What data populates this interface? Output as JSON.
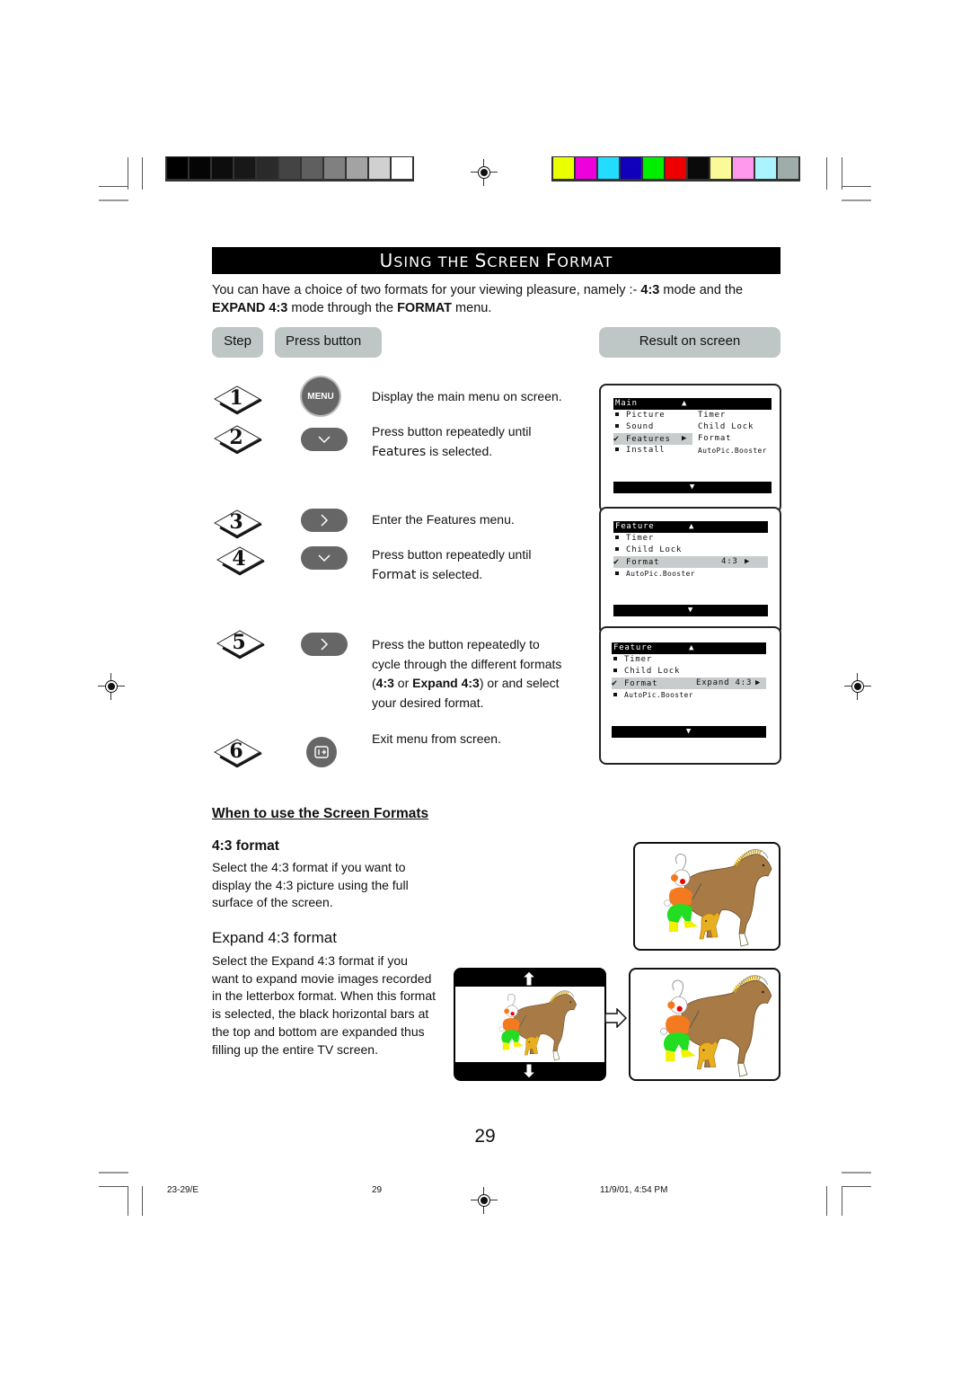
{
  "print_marks": {
    "gray_scale_swatches": [
      "#000000",
      "#050505",
      "#0d0d0d",
      "#181818",
      "#2a2a2a",
      "#444444",
      "#5f5f5f",
      "#808080",
      "#a3a3a3",
      "#d0d0d0",
      "#ffffff"
    ],
    "color_swatches": [
      "#eaff00",
      "#ee00dd",
      "#22ddff",
      "#1100bb",
      "#00ee00",
      "#ee0000",
      "#0a0a0a",
      "#fafa99",
      "#ff99ee",
      "#aaf4ff",
      "#9fadaa"
    ]
  },
  "header": {
    "title_first_U": "U",
    "title_rest_1": "SING THE ",
    "title_S": "S",
    "title_rest_2": "CREEN ",
    "title_F": "F",
    "title_rest_3": "ORMAT"
  },
  "intro": {
    "line1_a": "You can have a choice of two formats for your viewing pleasure, namely :- ",
    "line1_b": "4:3",
    "line1_c": " mode and the",
    "line2_a": "EXPAND 4:3",
    "line2_b": " mode through the ",
    "line2_c": "FORMAT",
    "line2_d": " menu."
  },
  "columns": {
    "step": "Step",
    "press_button": "Press button",
    "result": "Result on screen"
  },
  "steps": [
    {
      "num": "1",
      "button": "MENU",
      "button_icon": "menu-button",
      "text": "Display the main menu on screen."
    },
    {
      "num": "2",
      "button": "v",
      "button_icon": "down-arrow-button",
      "text_a": "Press button repeatedly until",
      "text_b_mono": "Features",
      "text_b_rest": " is selected."
    },
    {
      "num": "3",
      "button": ">",
      "button_icon": "right-arrow-button",
      "text": "Enter the Features menu."
    },
    {
      "num": "4",
      "button": "v",
      "button_icon": "down-arrow-button",
      "text_a": "Press button repeatedly until",
      "text_b_mono": "Format",
      "text_b_rest": " is selected."
    },
    {
      "num": "5",
      "button": ">",
      "button_icon": "right-arrow-button",
      "text_1": "Press the button repeatedly to",
      "text_2": "cycle through the different formats",
      "text_3_a": "(",
      "text_3_b": "4:3",
      "text_3_c": " or ",
      "text_3_d": "Expand 4:3",
      "text_3_e": ") or and select",
      "text_4": "your desired format."
    },
    {
      "num": "6",
      "button": "i+",
      "button_icon": "info-exit-button",
      "text": "Exit menu from screen."
    }
  ],
  "osd_screens": [
    {
      "title": "Main",
      "up": "▲",
      "down": "▼",
      "rows": [
        {
          "marker": "bullet",
          "label": "Picture",
          "right": "Timer"
        },
        {
          "marker": "bullet",
          "label": "Sound",
          "right": "Child Lock"
        },
        {
          "marker": "check",
          "label": "Features",
          "arrow": "▶",
          "right": "Format",
          "selected": true
        },
        {
          "marker": "bullet",
          "label": "Install",
          "right": "AutoPic.Booster"
        }
      ]
    },
    {
      "title": "Feature",
      "up": "▲",
      "down": "▼",
      "rows": [
        {
          "marker": "bullet",
          "label": "Timer"
        },
        {
          "marker": "bullet",
          "label": "Child Lock"
        },
        {
          "marker": "check",
          "label": "Format",
          "value": "4:3",
          "arrow": "▶",
          "selected": true
        },
        {
          "marker": "bullet",
          "label": "AutoPic.Booster"
        }
      ]
    },
    {
      "title": "Feature",
      "up": "▲",
      "down": "▼",
      "rows": [
        {
          "marker": "bullet",
          "label": "Timer"
        },
        {
          "marker": "bullet",
          "label": "Child Lock"
        },
        {
          "marker": "check",
          "label": "Format",
          "value": "Expand 4:3",
          "arrow": "▶",
          "selected": true
        },
        {
          "marker": "bullet",
          "label": "AutoPic.Booster"
        }
      ]
    }
  ],
  "when_section": {
    "heading": "When to use the Screen Formats",
    "format43_heading": "4:3 format",
    "format43_text": "Select the 4:3 format if you want to display the 4:3 picture using the full surface of the screen.",
    "expand_heading": "Expand 4:3 format",
    "expand_text": "Select the Expand 4:3 format if you want to expand movie images recorded in the letterbox format. When this format is selected, the black horizontal bars at the top and bottom are expanded thus filling up the entire TV screen."
  },
  "page_number": "29",
  "footer": {
    "left": "23-29/E",
    "center": "29",
    "right": "11/9/01, 4:54 PM"
  }
}
